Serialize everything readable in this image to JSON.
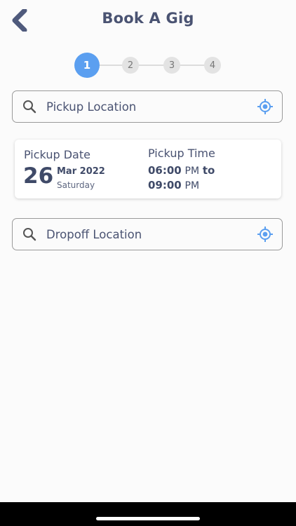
{
  "header": {
    "title": "Book A Gig",
    "back_icon": "chevron-left-icon"
  },
  "stepper": {
    "steps": [
      "1",
      "2",
      "3",
      "4"
    ],
    "active_step": "1"
  },
  "pickup": {
    "placeholder": "Pickup Location"
  },
  "schedule": {
    "date_label": "Pickup Date",
    "day": "26",
    "month_year": "Mar 2022",
    "weekday": "Saturday",
    "time_label": "Pickup Time",
    "start_time": "06:00",
    "start_ampm": "PM",
    "to_label": "to",
    "end_time": "09:00",
    "end_ampm": "PM"
  },
  "dropoff": {
    "placeholder": "Dropoff Location"
  },
  "colors": {
    "accent": "#5b9ff0",
    "text": "#4a5372",
    "back_icon": "#4f5a7c"
  }
}
